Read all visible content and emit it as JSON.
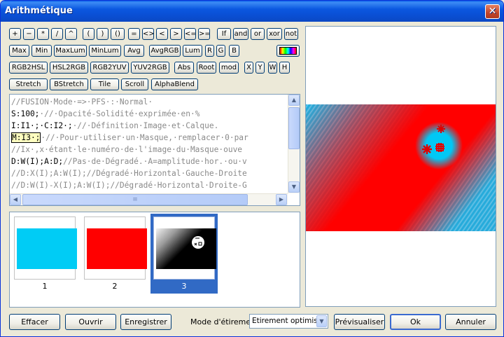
{
  "window": {
    "title": "Arithmétique",
    "close_glyph": "✕"
  },
  "toolbar": {
    "row1": [
      "+",
      "−",
      "*",
      "/",
      "^",
      "(",
      ")",
      "()",
      "=",
      "<>",
      "<",
      ">",
      "<=",
      ">=",
      "If",
      "and",
      "or",
      "xor",
      "not"
    ],
    "row2": [
      "Max",
      "Min",
      "MaxLum",
      "MinLum",
      "Avg",
      "AvgRGB",
      "Lum",
      "R",
      "G",
      "B"
    ],
    "row3": [
      "RGB2HSL",
      "HSL2RGB",
      "RGB2YUV",
      "YUV2RGB",
      "Abs",
      "Root",
      "mod",
      "X",
      "Y",
      "W",
      "H"
    ],
    "row4": [
      "Stretch",
      "BStretch",
      "Tile",
      "Scroll",
      "AlphaBlend"
    ],
    "palette_icon": "color-spectrum-icon"
  },
  "editor": {
    "lines": [
      [
        {
          "t": "//FUSION·Mode·=>·PFS·:·Normal·",
          "s": "comment"
        }
      ],
      [
        {
          "t": "S:100;",
          "s": "code"
        },
        {
          "t": "·//·Opacité-Solidité·exprimée·en·%",
          "s": "comment"
        }
      ],
      [
        {
          "t": "I:I1·;·C:I2·;",
          "s": "code"
        },
        {
          "t": "·//·Définition·Image·et·Calque.",
          "s": "comment"
        }
      ],
      [
        {
          "t": "M:I3·;",
          "s": "cursor"
        },
        {
          "t": "·//·Pour·utiliser·un·Masque,·remplacer·0·par",
          "s": "comment"
        }
      ],
      [
        {
          "t": "//Ix·,x·étant·le·numéro·de·l'image·du·Masque·ouve",
          "s": "comment"
        }
      ],
      [
        {
          "t": "D:W(I);A:D;",
          "s": "code"
        },
        {
          "t": "//Pas·de·Dégradé.·A=amplitude·hor.·ou·v",
          "s": "comment"
        }
      ],
      [
        {
          "t": "//D:X(I);A:W(I);//Dégradé·Horizontal·Gauche-Droite",
          "s": "comment"
        }
      ],
      [
        {
          "t": "//D:W(I)-X(I);A:W(I);//Dégradé·Horizontal·Droite-G",
          "s": "comment"
        }
      ]
    ],
    "scroll_up": "▲",
    "scroll_down": "▼",
    "scroll_left": "◀",
    "scroll_right": "▶",
    "grip": "≡"
  },
  "thumbnails": [
    {
      "label": "1",
      "kind": "cyan"
    },
    {
      "label": "2",
      "kind": "red"
    },
    {
      "label": "3",
      "kind": "mask",
      "selected": true
    }
  ],
  "colors": {
    "cyan": "#00ccf5",
    "red": "#ff0000",
    "select_blue": "#316ac5"
  },
  "footer": {
    "effacer": "Effacer",
    "ouvrir": "Ouvrir",
    "enregistrer": "Enregistrer",
    "mode_label": "Mode d'étirement",
    "mode_value": "Etirement optimisé",
    "dropdown_glyph": "▼",
    "previsualiser": "Prévisualiser",
    "ok": "Ok",
    "annuler": "Annuler"
  }
}
